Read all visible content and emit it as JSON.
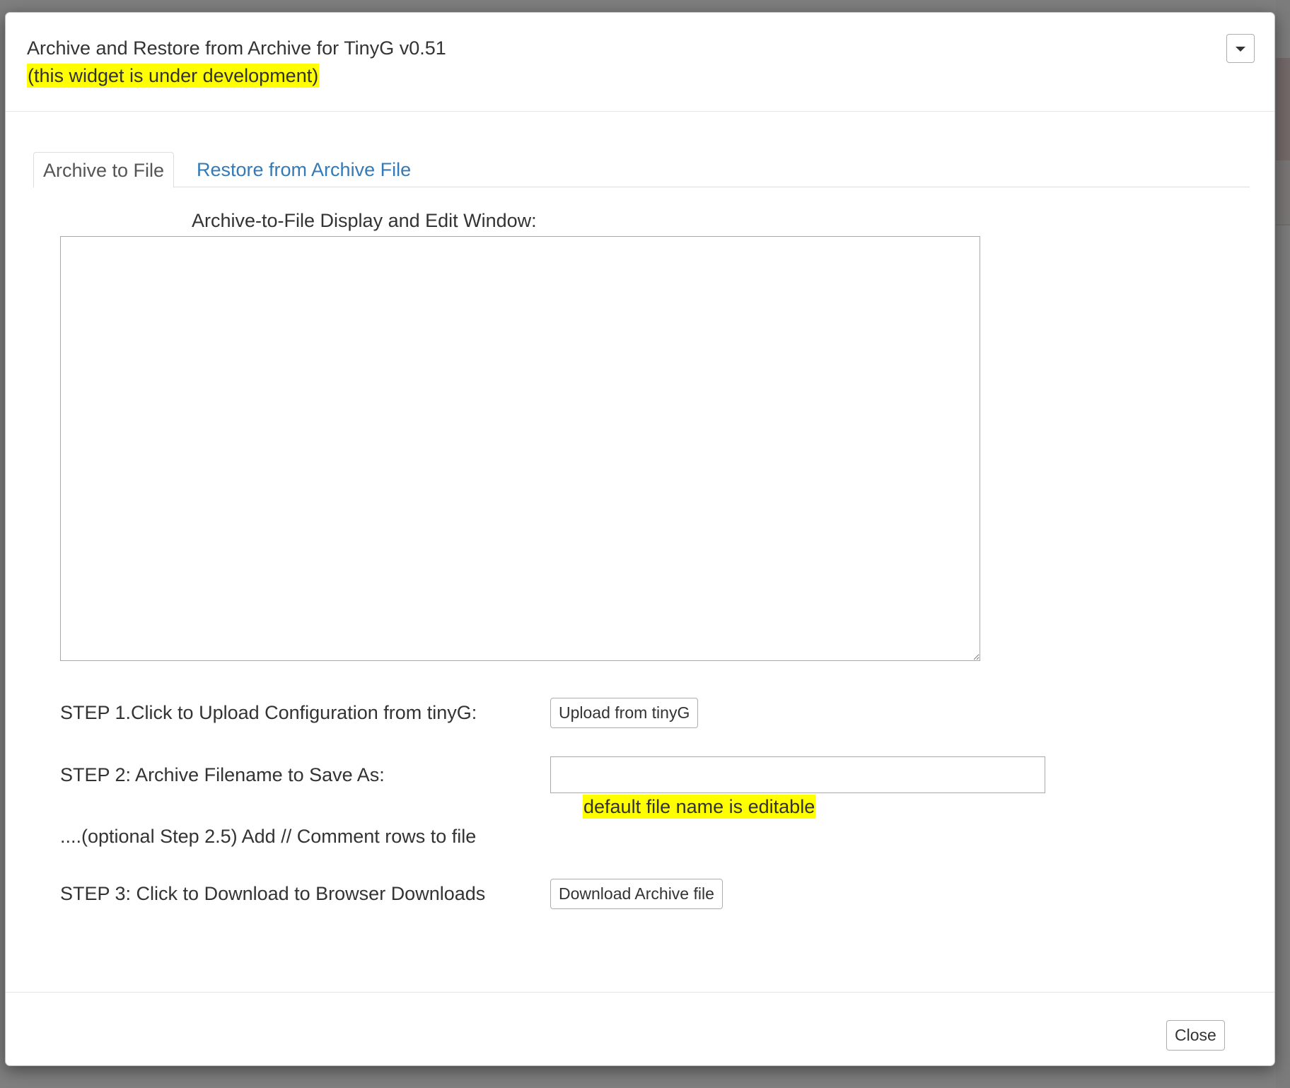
{
  "dialog": {
    "title": "Archive and Restore from Archive for TinyG v0.51",
    "dev_note": "(this widget is under development)",
    "dropdown_icon": "caret-down-icon"
  },
  "tabs": [
    {
      "label": "Archive to File",
      "active": true
    },
    {
      "label": "Restore from Archive File",
      "active": false
    }
  ],
  "archive_panel": {
    "display_label": "Archive-to-File Display and Edit Window:",
    "textarea_value": "",
    "step1_label": "STEP 1.Click to Upload Configuration from tinyG:",
    "upload_button": "Upload from tinyG",
    "step2_label": "STEP 2: Archive Filename to Save As:",
    "filename_value": "",
    "filename_note": "default file name is editable",
    "step25_label": "....(optional Step 2.5) Add // Comment rows to file",
    "step3_label": "STEP 3: Click to Download to Browser Downloads",
    "download_button": "Download Archive file"
  },
  "footer": {
    "close_button": "Close"
  },
  "colors": {
    "highlight": "#ffff00",
    "link": "#337ab7",
    "overlay": "#7f7f7f"
  }
}
